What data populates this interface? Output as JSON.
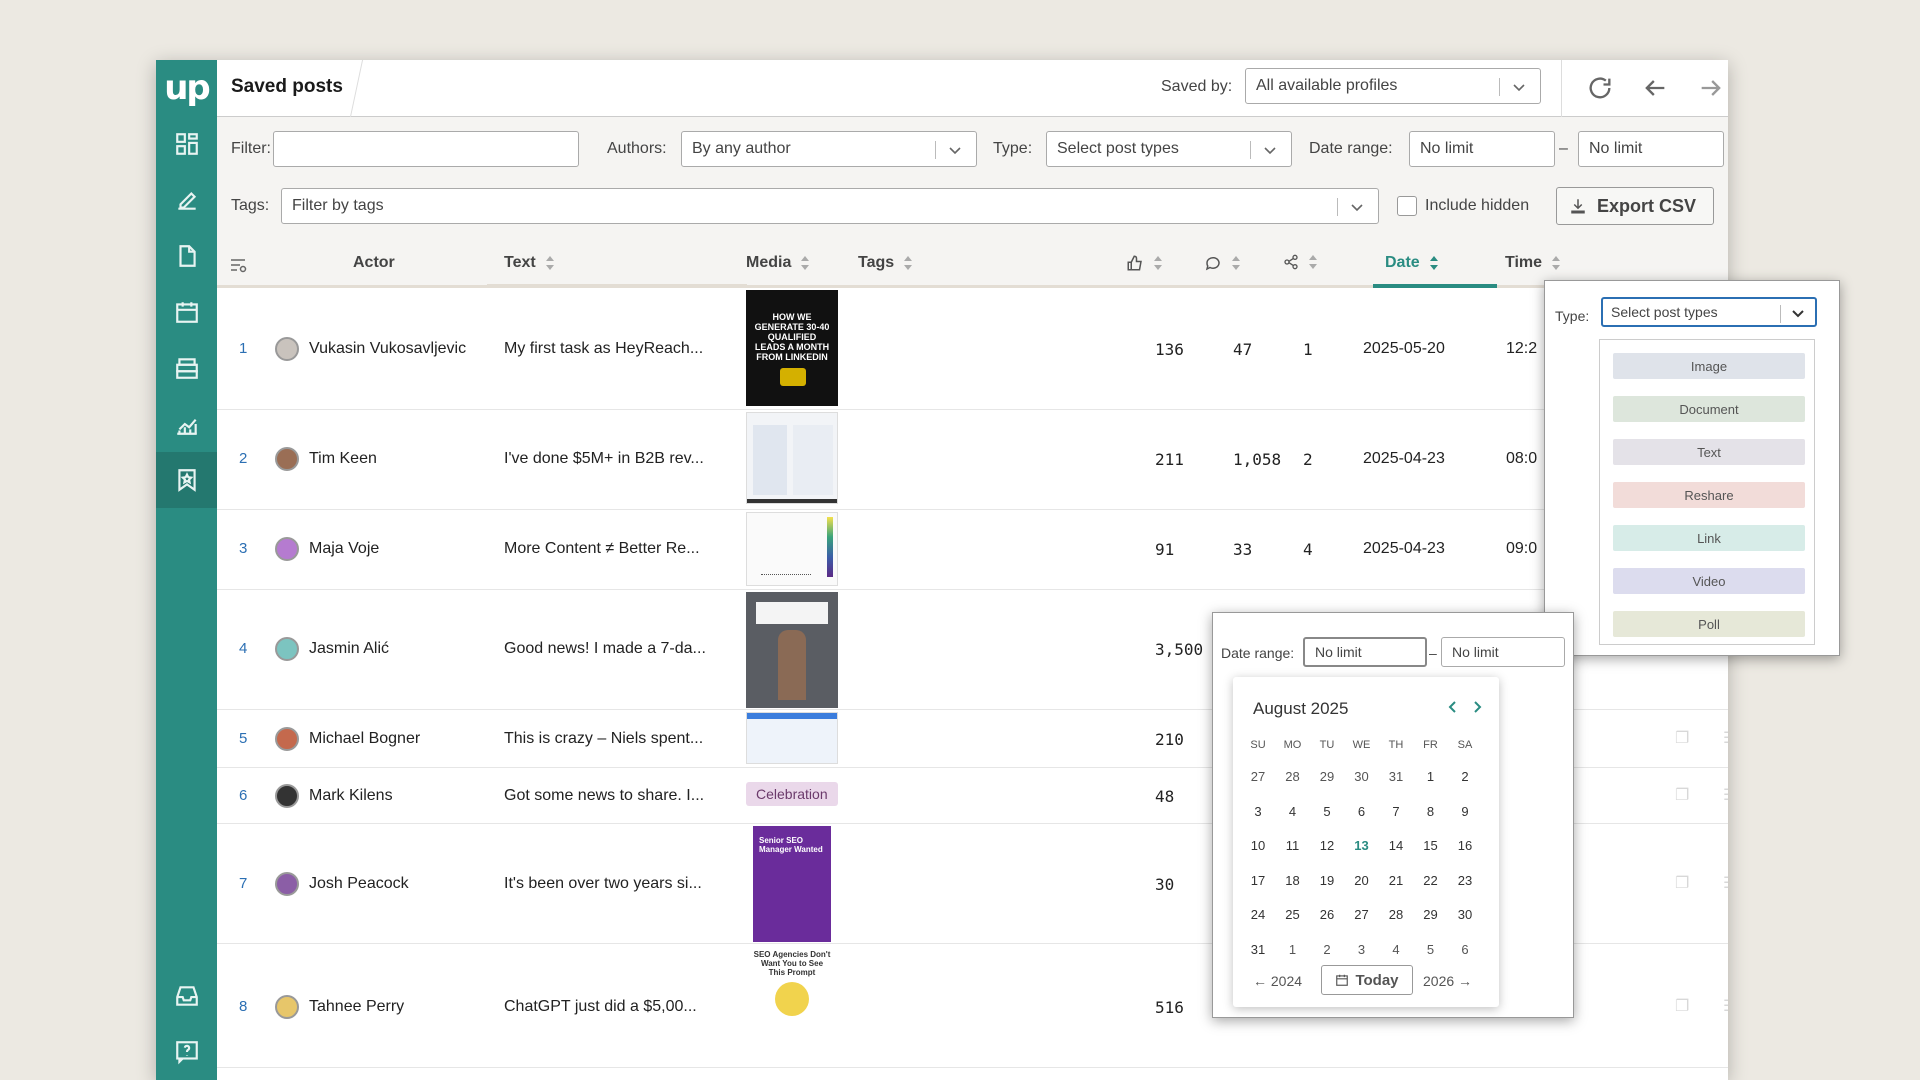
{
  "app": {
    "logo": "up",
    "title": "Saved posts"
  },
  "header": {
    "saved_by_label": "Saved by:",
    "saved_by_value": "All available profiles"
  },
  "filters": {
    "filter_label": "Filter:",
    "authors_label": "Authors:",
    "authors_value": "By any author",
    "type_label": "Type:",
    "type_placeholder": "Select post types",
    "date_label": "Date range:",
    "date_from": "No limit",
    "date_dash": "–",
    "date_to": "No limit",
    "tags_label": "Tags:",
    "tags_placeholder": "Filter by tags",
    "include_hidden": "Include hidden",
    "export": "Export CSV"
  },
  "columns": {
    "actor": "Actor",
    "text": "Text",
    "media": "Media",
    "tags": "Tags",
    "date": "Date",
    "time": "Time"
  },
  "rows": [
    {
      "n": "1",
      "actor": "Vukasin Vukosavljevic",
      "text": "My first task as HeyReach...",
      "likes": "136",
      "comments": "47",
      "shares": "1",
      "date": "2025-05-20",
      "time": "12:2"
    },
    {
      "n": "2",
      "actor": "Tim Keen",
      "text": "I've done $5M+ in B2B rev...",
      "likes": "211",
      "comments": "1,058",
      "shares": "2",
      "date": "2025-04-23",
      "time": "08:0"
    },
    {
      "n": "3",
      "actor": "Maja Voje",
      "text": "More Content ≠ Better Re...",
      "likes": "91",
      "comments": "33",
      "shares": "4",
      "date": "2025-04-23",
      "time": "09:0"
    },
    {
      "n": "4",
      "actor": "Jasmin Alić",
      "text": "Good news! I made a 7-da...",
      "likes": "3,500"
    },
    {
      "n": "5",
      "actor": "Michael Bogner",
      "text": "This is crazy – Niels spent...",
      "likes": "210"
    },
    {
      "n": "6",
      "actor": "Mark Kilens",
      "text": "Got some news to share. I...",
      "likes": "48",
      "badge": "Celebration"
    },
    {
      "n": "7",
      "actor": "Josh Peacock",
      "text": "It's been over two years si...",
      "likes": "30"
    },
    {
      "n": "8",
      "actor": "Tahnee Perry",
      "text": "ChatGPT just did a $5,00...",
      "likes": "516"
    }
  ],
  "media_text": {
    "m1": "HOW WE GENERATE 30-40 QUALIFIED LEADS A MONTH FROM LINKEDIN",
    "m7": "Senior SEO Manager Wanted",
    "m8": "SEO Agencies Don't Want You to See This Prompt"
  },
  "type_popup": {
    "label": "Type:",
    "placeholder": "Select post types",
    "options": [
      "Image",
      "Document",
      "Text",
      "Reshare",
      "Link",
      "Video",
      "Poll"
    ]
  },
  "date_popup": {
    "label": "Date range:",
    "from": "No limit",
    "dash": "–",
    "to": "No limit",
    "month": "August 2025",
    "dow": [
      "SU",
      "MO",
      "TU",
      "WE",
      "TH",
      "FR",
      "SA"
    ],
    "weeks": [
      [
        "27",
        "28",
        "29",
        "30",
        "31",
        "1",
        "2"
      ],
      [
        "3",
        "4",
        "5",
        "6",
        "7",
        "8",
        "9"
      ],
      [
        "10",
        "11",
        "12",
        "13",
        "14",
        "15",
        "16"
      ],
      [
        "17",
        "18",
        "19",
        "20",
        "21",
        "22",
        "23"
      ],
      [
        "24",
        "25",
        "26",
        "27",
        "28",
        "29",
        "30"
      ],
      [
        "31",
        "1",
        "2",
        "3",
        "4",
        "5",
        "6"
      ]
    ],
    "prev_year": "← 2024",
    "today": "Today",
    "next_year": "2026 →"
  },
  "colors": {
    "brand": "#2a8c82",
    "link": "#2b6fb3"
  }
}
